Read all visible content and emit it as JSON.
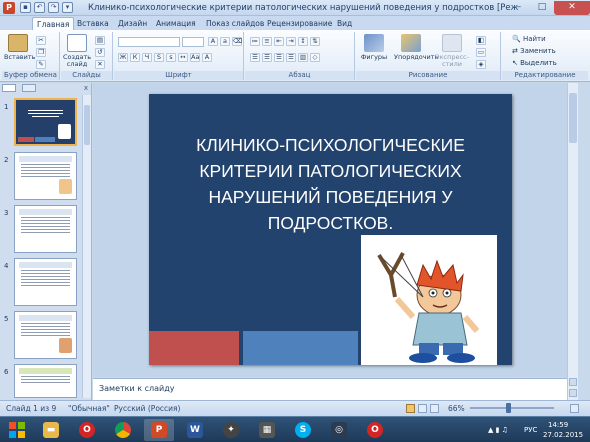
{
  "window": {
    "title": "Клинико-психологические критерии патологических нарушений поведения у подростков [Режим со...",
    "minimize": "–",
    "maximize": "□",
    "close": "✕"
  },
  "tabs": [
    "Главная",
    "Вставка",
    "Дизайн",
    "Анимация",
    "Показ слайдов",
    "Рецензирование",
    "Вид"
  ],
  "ribbon": {
    "paste": "Вставить",
    "new_slide": "Создать слайд",
    "shapes": "Фигуры",
    "arrange": "Упорядочить",
    "quick_styles": "Экспресс-стили",
    "find": "Найти",
    "replace": "Заменить",
    "select": "Выделить",
    "groups": [
      "Буфер обмена",
      "Слайды",
      "Шрифт",
      "Абзац",
      "Рисование",
      "Редактирование"
    ]
  },
  "slide_panel": {
    "tab_slides": "Слайды",
    "tab_outline": "Структура",
    "close": "x",
    "numbers": [
      "1",
      "2",
      "3",
      "4",
      "5",
      "6"
    ]
  },
  "slide": {
    "title": "КЛИНИКО-ПСИХОЛОГИЧЕСКИЕ\nКРИТЕРИИ ПАТОЛОГИЧЕСКИХ\nНАРУШЕНИЙ ПОВЕДЕНИЯ У\nПОДРОСТКОВ.",
    "accent_red": "#c0504d",
    "accent_blue": "#4f81bd",
    "background": "#22436e"
  },
  "notes_placeholder": "Заметки к слайду",
  "statusbar": {
    "slide_info": "Слайд 1 из 9",
    "theme": "\"Обычная\"",
    "language": "Русский (Россия)",
    "zoom": "66%"
  },
  "taskbar": {
    "lang": "РУС",
    "time": "14:59",
    "date": "27.02.2015"
  }
}
